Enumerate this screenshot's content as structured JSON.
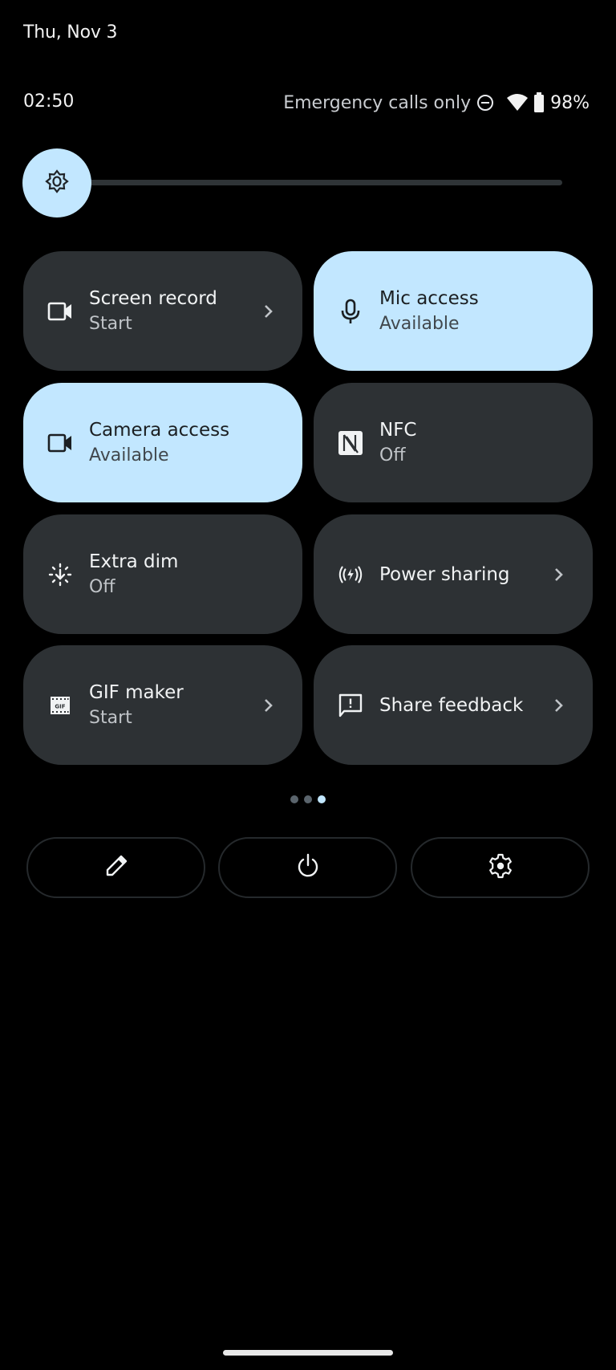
{
  "header": {
    "date": "Thu, Nov 3",
    "clock": "02:50",
    "network_status": "Emergency calls only",
    "battery_percent": "98%",
    "status_icons": [
      "do-not-disturb-icon",
      "wifi-icon",
      "battery-icon"
    ]
  },
  "brightness": {
    "icon": "brightness-icon",
    "level_fraction": 0.0
  },
  "tiles": [
    {
      "title": "Screen record",
      "subtitle": "Start",
      "icon": "videocam-icon",
      "active": false,
      "chevron": true
    },
    {
      "title": "Mic access",
      "subtitle": "Available",
      "icon": "mic-icon",
      "active": true,
      "chevron": false
    },
    {
      "title": "Camera access",
      "subtitle": "Available",
      "icon": "videocam-icon",
      "active": true,
      "chevron": false
    },
    {
      "title": "NFC",
      "subtitle": "Off",
      "icon": "nfc-icon",
      "active": false,
      "chevron": false
    },
    {
      "title": "Extra dim",
      "subtitle": "Off",
      "icon": "extra-dim-icon",
      "active": false,
      "chevron": false
    },
    {
      "title": "Power sharing",
      "subtitle": "",
      "icon": "power-sharing-icon",
      "active": false,
      "chevron": true
    },
    {
      "title": "GIF maker",
      "subtitle": "Start",
      "icon": "gif-icon",
      "active": false,
      "chevron": true
    },
    {
      "title": "Share feedback",
      "subtitle": "",
      "icon": "feedback-icon",
      "active": false,
      "chevron": true
    }
  ],
  "pager": {
    "pages": 3,
    "current": 3
  },
  "footer_buttons": [
    {
      "name": "edit",
      "icon": "pencil-icon"
    },
    {
      "name": "power",
      "icon": "power-icon"
    },
    {
      "name": "settings",
      "icon": "gear-icon"
    }
  ],
  "colors": {
    "accent": "#c2e7ff",
    "tile_inactive": "#2d3134",
    "background": "#000000"
  }
}
